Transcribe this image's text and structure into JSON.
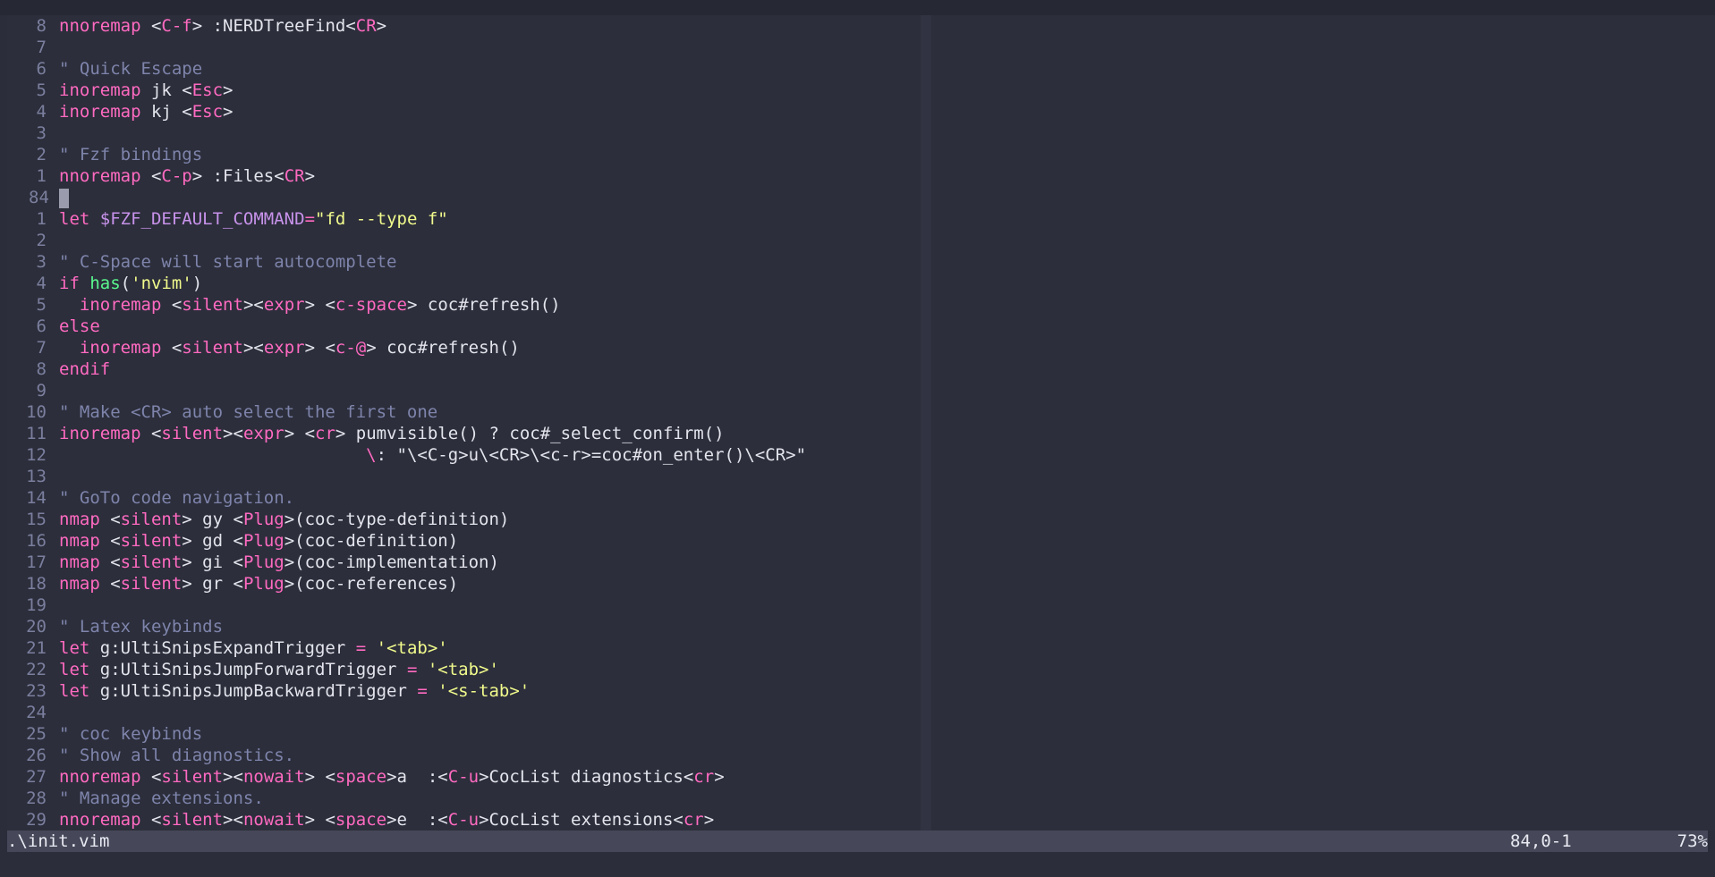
{
  "editor": {
    "lines": [
      {
        "num": "8",
        "tokens": [
          [
            "kw",
            "nnoremap"
          ],
          [
            "tx",
            " <"
          ],
          [
            "kw",
            "C-f"
          ],
          [
            "tx",
            "> :NERDTreeFind<"
          ],
          [
            "kw",
            "CR"
          ],
          [
            "tx",
            ">"
          ]
        ]
      },
      {
        "num": "7",
        "tokens": []
      },
      {
        "num": "6",
        "tokens": [
          [
            "cm",
            "\" Quick Escape"
          ]
        ]
      },
      {
        "num": "5",
        "tokens": [
          [
            "kw",
            "inoremap"
          ],
          [
            "tx",
            " jk <"
          ],
          [
            "kw",
            "Esc"
          ],
          [
            "tx",
            ">"
          ]
        ]
      },
      {
        "num": "4",
        "tokens": [
          [
            "kw",
            "inoremap"
          ],
          [
            "tx",
            " kj <"
          ],
          [
            "kw",
            "Esc"
          ],
          [
            "tx",
            ">"
          ]
        ]
      },
      {
        "num": "3",
        "tokens": []
      },
      {
        "num": "2",
        "tokens": [
          [
            "cm",
            "\" Fzf bindings"
          ]
        ]
      },
      {
        "num": "1",
        "tokens": [
          [
            "kw",
            "nnoremap"
          ],
          [
            "tx",
            " <"
          ],
          [
            "kw",
            "C-p"
          ],
          [
            "tx",
            "> :Files<"
          ],
          [
            "kw",
            "CR"
          ],
          [
            "tx",
            ">"
          ]
        ]
      },
      {
        "num": "84",
        "current": true,
        "tokens": []
      },
      {
        "num": "1",
        "tokens": [
          [
            "kw",
            "let"
          ],
          [
            "tx",
            " "
          ],
          [
            "var",
            "$FZF_DEFAULT_COMMAND"
          ],
          [
            "op",
            "="
          ],
          [
            "str",
            "\"fd --type f\""
          ]
        ]
      },
      {
        "num": "2",
        "tokens": []
      },
      {
        "num": "3",
        "tokens": [
          [
            "cm",
            "\" C-Space will start autocomplete"
          ]
        ]
      },
      {
        "num": "4",
        "tokens": [
          [
            "kw",
            "if"
          ],
          [
            "tx",
            " "
          ],
          [
            "fn",
            "has"
          ],
          [
            "tx",
            "("
          ],
          [
            "str",
            "'nvim'"
          ],
          [
            "tx",
            ")"
          ]
        ]
      },
      {
        "num": "5",
        "tokens": [
          [
            "tx",
            "  "
          ],
          [
            "kw",
            "inoremap"
          ],
          [
            "tx",
            " <"
          ],
          [
            "kw",
            "silent"
          ],
          [
            "tx",
            "><"
          ],
          [
            "kw",
            "expr"
          ],
          [
            "tx",
            "> <"
          ],
          [
            "kw",
            "c-space"
          ],
          [
            "tx",
            "> coc#refresh()"
          ]
        ]
      },
      {
        "num": "6",
        "tokens": [
          [
            "kw",
            "else"
          ]
        ]
      },
      {
        "num": "7",
        "tokens": [
          [
            "tx",
            "  "
          ],
          [
            "kw",
            "inoremap"
          ],
          [
            "tx",
            " <"
          ],
          [
            "kw",
            "silent"
          ],
          [
            "tx",
            "><"
          ],
          [
            "kw",
            "expr"
          ],
          [
            "tx",
            "> <"
          ],
          [
            "kw",
            "c-@"
          ],
          [
            "tx",
            "> coc#refresh()"
          ]
        ]
      },
      {
        "num": "8",
        "tokens": [
          [
            "kw",
            "endif"
          ]
        ]
      },
      {
        "num": "9",
        "tokens": []
      },
      {
        "num": "10",
        "tokens": [
          [
            "cm",
            "\" Make <CR> auto select the first one"
          ]
        ]
      },
      {
        "num": "11",
        "tokens": [
          [
            "kw",
            "inoremap"
          ],
          [
            "tx",
            " <"
          ],
          [
            "kw",
            "silent"
          ],
          [
            "tx",
            "><"
          ],
          [
            "kw",
            "expr"
          ],
          [
            "tx",
            "> <"
          ],
          [
            "kw",
            "cr"
          ],
          [
            "tx",
            "> pumvisible() ? coc#_select_confirm()"
          ]
        ]
      },
      {
        "num": "12",
        "tokens": [
          [
            "tx",
            "                              "
          ],
          [
            "kw",
            "\\"
          ],
          [
            "tx",
            ": \"\\<C-g>u\\<CR>\\<c-r>=coc#on_enter()\\<CR>\""
          ]
        ]
      },
      {
        "num": "13",
        "tokens": []
      },
      {
        "num": "14",
        "tokens": [
          [
            "cm",
            "\" GoTo code navigation."
          ]
        ]
      },
      {
        "num": "15",
        "tokens": [
          [
            "kw",
            "nmap"
          ],
          [
            "tx",
            " <"
          ],
          [
            "kw",
            "silent"
          ],
          [
            "tx",
            "> gy <"
          ],
          [
            "kw",
            "Plug"
          ],
          [
            "tx",
            ">(coc-type-definition)"
          ]
        ]
      },
      {
        "num": "16",
        "tokens": [
          [
            "kw",
            "nmap"
          ],
          [
            "tx",
            " <"
          ],
          [
            "kw",
            "silent"
          ],
          [
            "tx",
            "> gd <"
          ],
          [
            "kw",
            "Plug"
          ],
          [
            "tx",
            ">(coc-definition)"
          ]
        ]
      },
      {
        "num": "17",
        "tokens": [
          [
            "kw",
            "nmap"
          ],
          [
            "tx",
            " <"
          ],
          [
            "kw",
            "silent"
          ],
          [
            "tx",
            "> gi <"
          ],
          [
            "kw",
            "Plug"
          ],
          [
            "tx",
            ">(coc-implementation)"
          ]
        ]
      },
      {
        "num": "18",
        "tokens": [
          [
            "kw",
            "nmap"
          ],
          [
            "tx",
            " <"
          ],
          [
            "kw",
            "silent"
          ],
          [
            "tx",
            "> gr <"
          ],
          [
            "kw",
            "Plug"
          ],
          [
            "tx",
            ">(coc-references)"
          ]
        ]
      },
      {
        "num": "19",
        "tokens": []
      },
      {
        "num": "20",
        "tokens": [
          [
            "cm",
            "\" Latex keybinds"
          ]
        ]
      },
      {
        "num": "21",
        "tokens": [
          [
            "kw",
            "let"
          ],
          [
            "tx",
            " g:UltiSnipsExpandTrigger "
          ],
          [
            "op",
            "="
          ],
          [
            "tx",
            " "
          ],
          [
            "str",
            "'<tab>'"
          ]
        ]
      },
      {
        "num": "22",
        "tokens": [
          [
            "kw",
            "let"
          ],
          [
            "tx",
            " g:UltiSnipsJumpForwardTrigger "
          ],
          [
            "op",
            "="
          ],
          [
            "tx",
            " "
          ],
          [
            "str",
            "'<tab>'"
          ]
        ]
      },
      {
        "num": "23",
        "tokens": [
          [
            "kw",
            "let"
          ],
          [
            "tx",
            " g:UltiSnipsJumpBackwardTrigger "
          ],
          [
            "op",
            "="
          ],
          [
            "tx",
            " "
          ],
          [
            "str",
            "'<s-tab>'"
          ]
        ]
      },
      {
        "num": "24",
        "tokens": []
      },
      {
        "num": "25",
        "tokens": [
          [
            "cm",
            "\" coc keybinds"
          ]
        ]
      },
      {
        "num": "26",
        "tokens": [
          [
            "cm",
            "\" Show all diagnostics."
          ]
        ]
      },
      {
        "num": "27",
        "tokens": [
          [
            "kw",
            "nnoremap"
          ],
          [
            "tx",
            " <"
          ],
          [
            "kw",
            "silent"
          ],
          [
            "tx",
            "><"
          ],
          [
            "kw",
            "nowait"
          ],
          [
            "tx",
            "> <"
          ],
          [
            "kw",
            "space"
          ],
          [
            "tx",
            ">a  :<"
          ],
          [
            "kw",
            "C-u"
          ],
          [
            "tx",
            ">CocList diagnostics<"
          ],
          [
            "kw",
            "cr"
          ],
          [
            "tx",
            ">"
          ]
        ]
      },
      {
        "num": "28",
        "tokens": [
          [
            "cm",
            "\" Manage extensions."
          ]
        ]
      },
      {
        "num": "29",
        "tokens": [
          [
            "kw",
            "nnoremap"
          ],
          [
            "tx",
            " <"
          ],
          [
            "kw",
            "silent"
          ],
          [
            "tx",
            "><"
          ],
          [
            "kw",
            "nowait"
          ],
          [
            "tx",
            "> <"
          ],
          [
            "kw",
            "space"
          ],
          [
            "tx",
            ">e  :<"
          ],
          [
            "kw",
            "C-u"
          ],
          [
            "tx",
            ">CocList extensions<"
          ],
          [
            "kw",
            "cr"
          ],
          [
            "tx",
            ">"
          ]
        ]
      }
    ]
  },
  "statusline": {
    "filename": ".\\init.vim",
    "position": "84,0-1",
    "percent": "73%"
  },
  "colors": {
    "background": "#2c2e3b",
    "keyword": "#ff6ac1",
    "comment": "#7e84ab",
    "string": "#f1fa8c",
    "function": "#5af78e",
    "variable": "#c792ea",
    "statusline_bg": "#464859"
  }
}
